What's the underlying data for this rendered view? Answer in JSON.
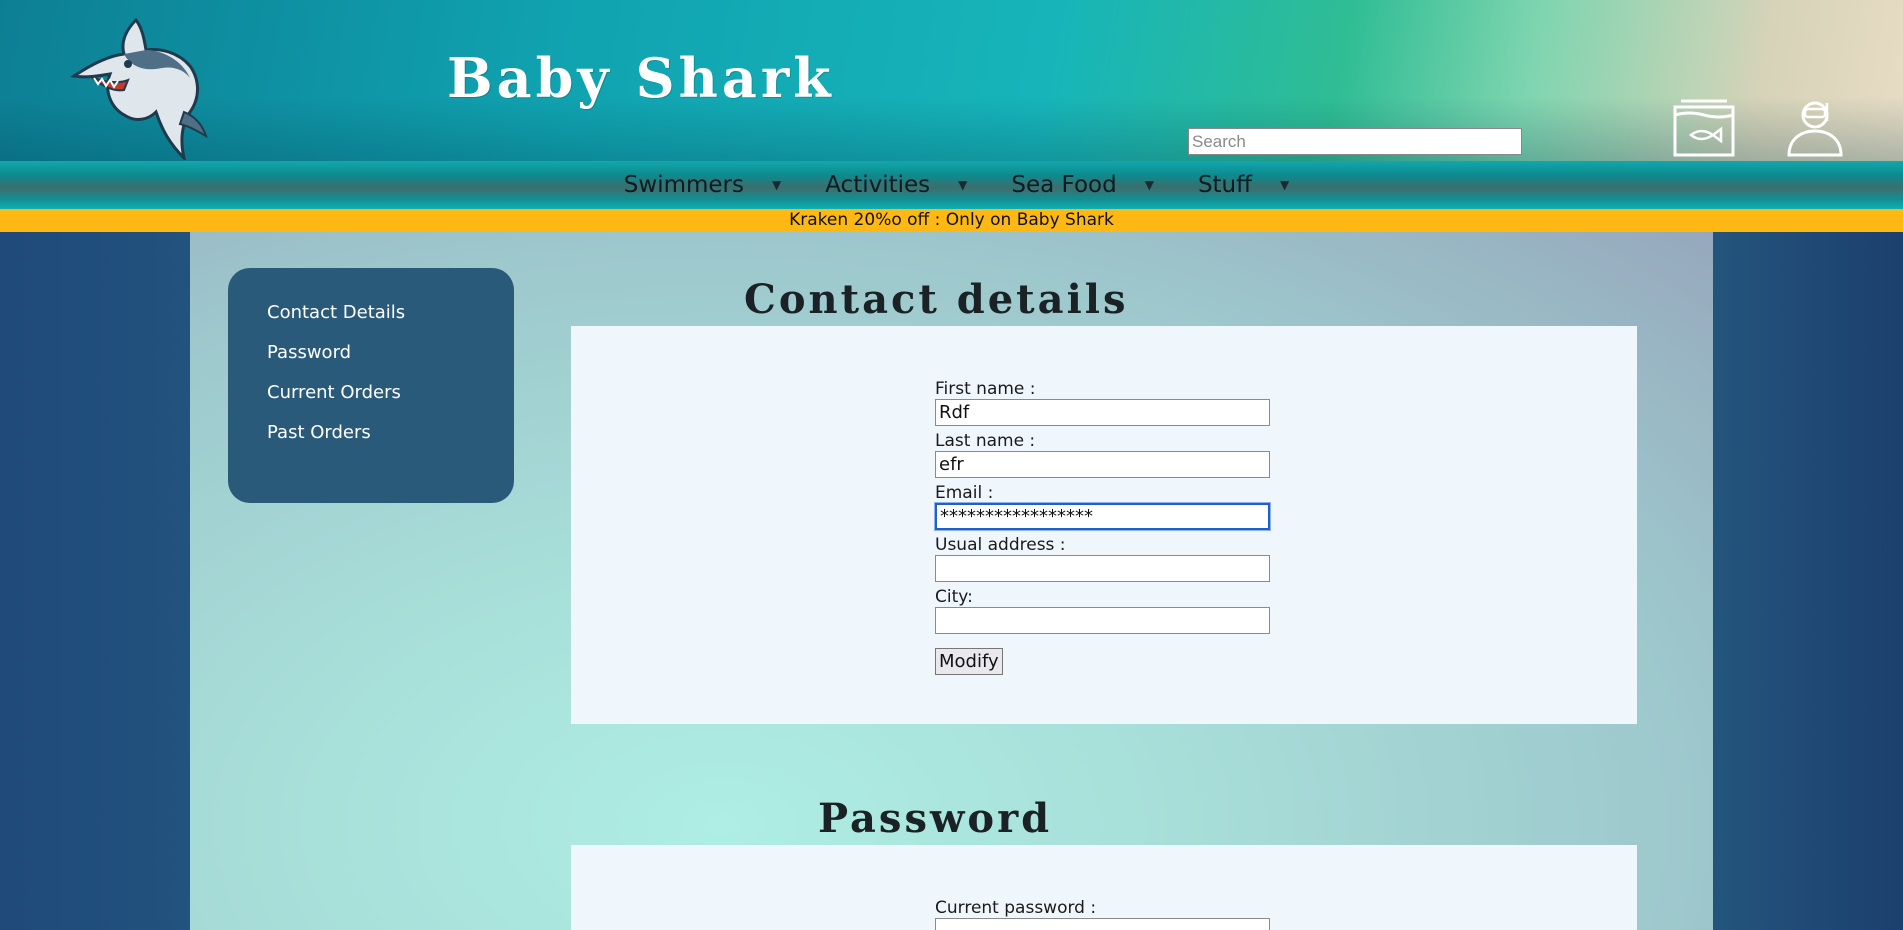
{
  "header": {
    "site_title": "Baby Shark",
    "search": {
      "placeholder": "Search",
      "value": ""
    },
    "icons": [
      "shark-logo",
      "aquarium-cart-icon",
      "diver-user-icon"
    ]
  },
  "nav": {
    "items": [
      {
        "label": "Swimmers",
        "icon": "caret-down-icon"
      },
      {
        "label": "Activities",
        "icon": "caret-down-icon"
      },
      {
        "label": "Sea Food",
        "icon": "caret-down-icon"
      },
      {
        "label": "Stuff",
        "icon": "caret-down-icon"
      }
    ],
    "caret": "▼"
  },
  "promo": {
    "text": "Kraken 20%o off : Only on Baby Shark"
  },
  "sidebar": {
    "items": [
      {
        "label": "Contact Details"
      },
      {
        "label": "Password"
      },
      {
        "label": "Current Orders"
      },
      {
        "label": "Past Orders"
      }
    ]
  },
  "contact": {
    "title": "Contact details",
    "fields": [
      {
        "label": "First name :",
        "value": "Rdf"
      },
      {
        "label": "Last name :",
        "value": "efr"
      },
      {
        "label": "Email :",
        "value": "*****************"
      },
      {
        "label": "Usual address :",
        "value": ""
      },
      {
        "label": "City:",
        "value": ""
      }
    ],
    "submit_label": "Modify"
  },
  "password": {
    "title": "Password",
    "fields": [
      {
        "label": "Current password :",
        "value": ""
      }
    ]
  },
  "colors": {
    "promo_bg": "#fdb813",
    "sidebar_bg": "#2a5a79",
    "card_bg": "#eff6fc",
    "header_teal": "#10a3b0"
  }
}
